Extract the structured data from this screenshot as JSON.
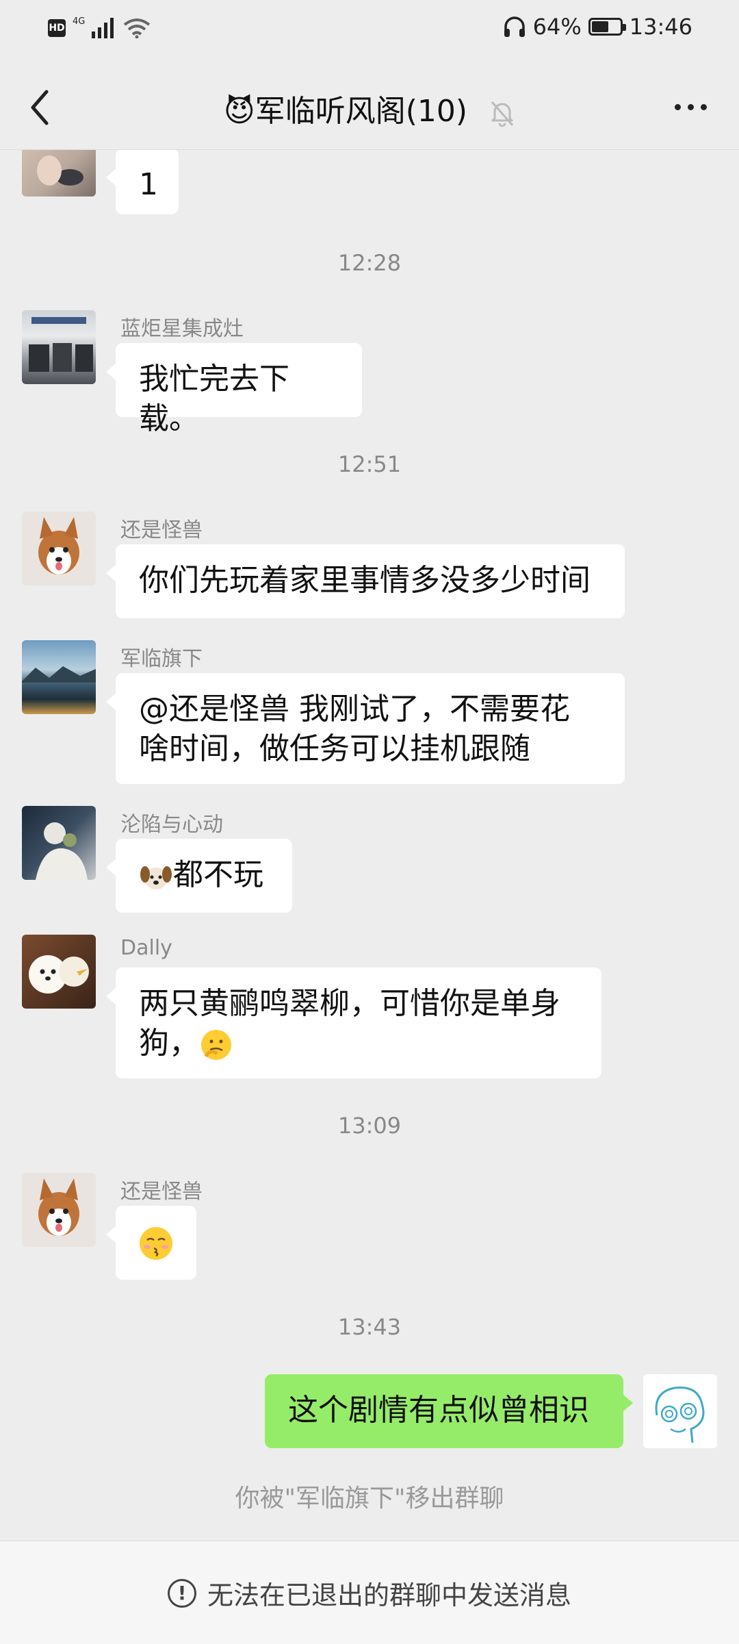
{
  "status": {
    "network": "4G",
    "battery": "64%",
    "battery_level": 0.64,
    "time": "13:46"
  },
  "header": {
    "title_emoji": "😈",
    "title": "军临听风阁(10)"
  },
  "messages": {
    "m0": {
      "text": "1"
    },
    "t1": "12:28",
    "m1": {
      "sender": "蓝炬星集成灶",
      "text": "我忙完去下载。"
    },
    "t2": "12:51",
    "m2": {
      "sender": "还是怪兽",
      "text": "你们先玩着家里事情多没多少时间"
    },
    "m3": {
      "sender": "军临旗下",
      "line1": "@还是怪兽  我刚试了，不需要花",
      "line2": "啥时间，做任务可以挂机跟随"
    },
    "m4": {
      "sender": "沦陷与心动",
      "text": "都不玩"
    },
    "m5": {
      "sender": "Dally",
      "line1": "两只黄鹂鸣翠柳，可惜你是单身",
      "line2": "狗，"
    },
    "t3": "13:09",
    "m6": {
      "sender": "还是怪兽"
    },
    "t4": "13:43",
    "m7": {
      "text": "这个剧情有点似曾相识"
    },
    "system": "你被\"军临旗下\"移出群聊"
  },
  "footer": {
    "notice": "无法在已退出的群聊中发送消息"
  }
}
